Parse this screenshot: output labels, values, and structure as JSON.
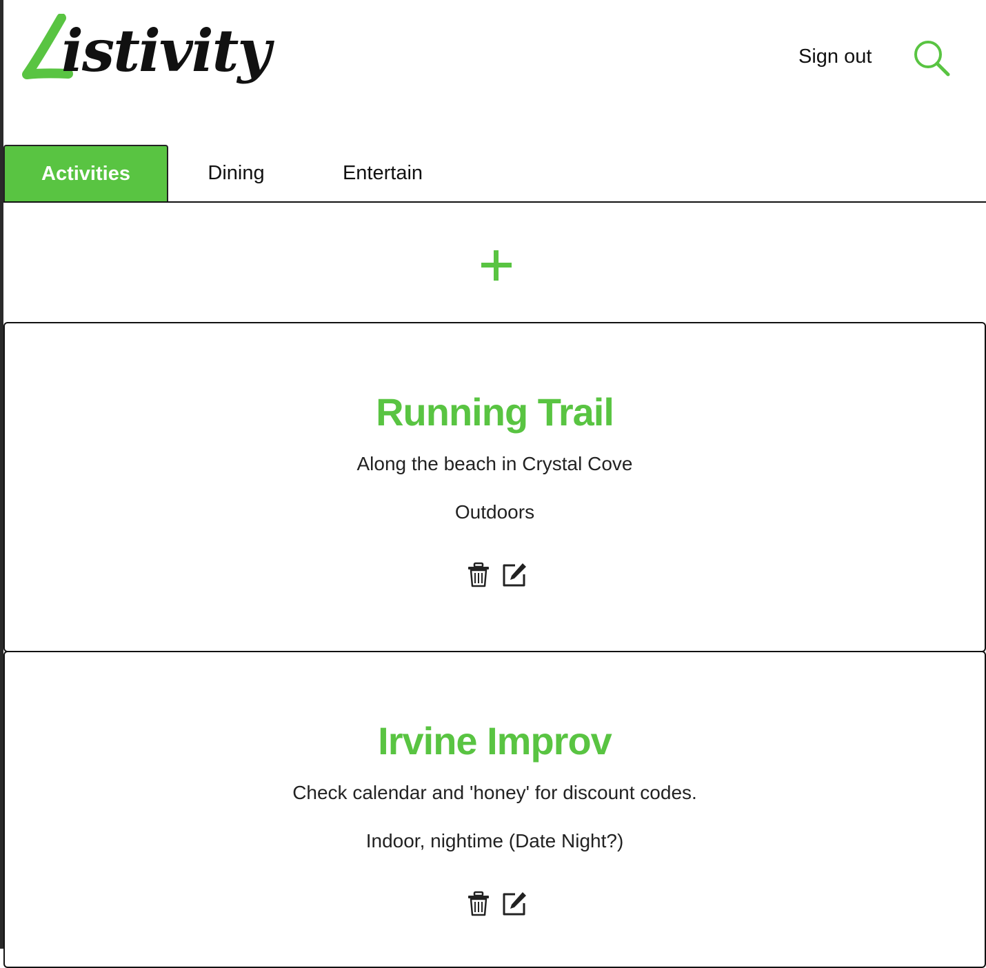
{
  "app": {
    "logo_text": "Listivity",
    "brand_color": "#59c442",
    "logo_initial_color": "#59c442"
  },
  "header": {
    "sign_out_label": "Sign out",
    "search_icon": "search-icon"
  },
  "tabs": [
    {
      "label": "Activities",
      "active": true
    },
    {
      "label": "Dining",
      "active": false
    },
    {
      "label": "Entertain",
      "active": false
    }
  ],
  "add_button": {
    "icon": "plus-icon",
    "label": "+"
  },
  "cards": [
    {
      "title": "Running Trail",
      "description": "Along the beach in Crystal Cove",
      "category": "Outdoors",
      "actions": [
        "trash-icon",
        "edit-icon"
      ]
    },
    {
      "title": "Irvine Improv",
      "description": "Check calendar and 'honey' for discount codes.",
      "category": "Indoor, nightime (Date Night?)",
      "actions": [
        "trash-icon",
        "edit-icon"
      ]
    }
  ]
}
